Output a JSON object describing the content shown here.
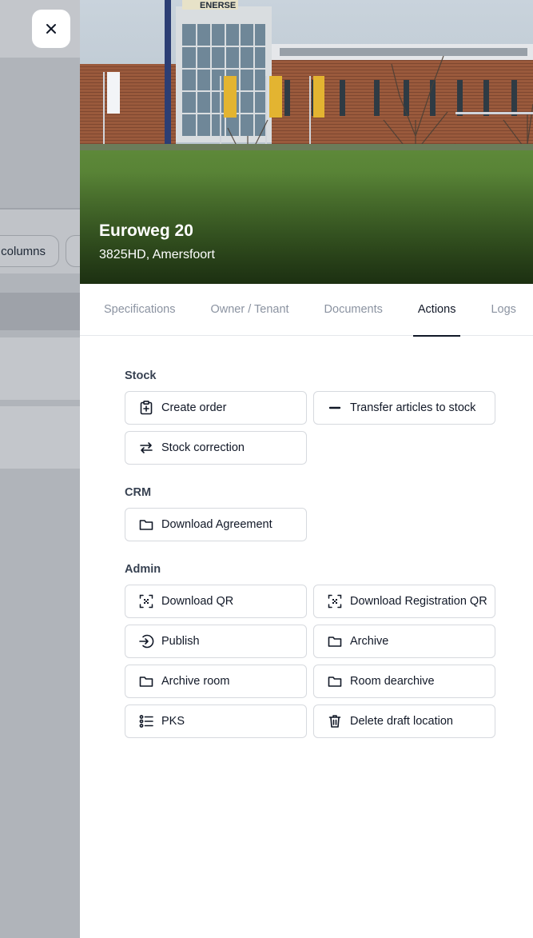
{
  "background": {
    "chip_label": "columns"
  },
  "header": {
    "title": "Euroweg 20",
    "address": "3825HD, Amersfoort",
    "building_sign": "ENERSE"
  },
  "tabs": [
    {
      "label": "Specifications",
      "active": false
    },
    {
      "label": "Owner / Tenant",
      "active": false
    },
    {
      "label": "Documents",
      "active": false
    },
    {
      "label": "Actions",
      "active": true
    },
    {
      "label": "Logs",
      "active": false
    }
  ],
  "sections": {
    "stock": {
      "title": "Stock",
      "buttons": [
        {
          "label": "Create order",
          "icon": "clipboard-plus-icon"
        },
        {
          "label": "Transfer articles to stock",
          "icon": "minus-icon"
        },
        {
          "label": "Stock correction",
          "icon": "arrows-swap-icon"
        }
      ]
    },
    "crm": {
      "title": "CRM",
      "buttons": [
        {
          "label": "Download Agreement",
          "icon": "folder-icon"
        }
      ]
    },
    "admin": {
      "title": "Admin",
      "buttons": [
        {
          "label": "Download QR",
          "icon": "qr-scan-icon"
        },
        {
          "label": "Download Registration QR",
          "icon": "qr-scan-icon"
        },
        {
          "label": "Publish",
          "icon": "sign-in-icon"
        },
        {
          "label": "Archive",
          "icon": "folder-icon"
        },
        {
          "label": "Archive room",
          "icon": "folder-icon"
        },
        {
          "label": "Room dearchive",
          "icon": "folder-icon"
        },
        {
          "label": "PKS",
          "icon": "list-icon"
        },
        {
          "label": "Delete draft location",
          "icon": "trash-icon"
        }
      ]
    }
  },
  "colors": {
    "overlay": "#b0b4ba",
    "active_tab": "#111827",
    "inactive_tab": "#8b93a1",
    "border": "#d6d9de"
  }
}
